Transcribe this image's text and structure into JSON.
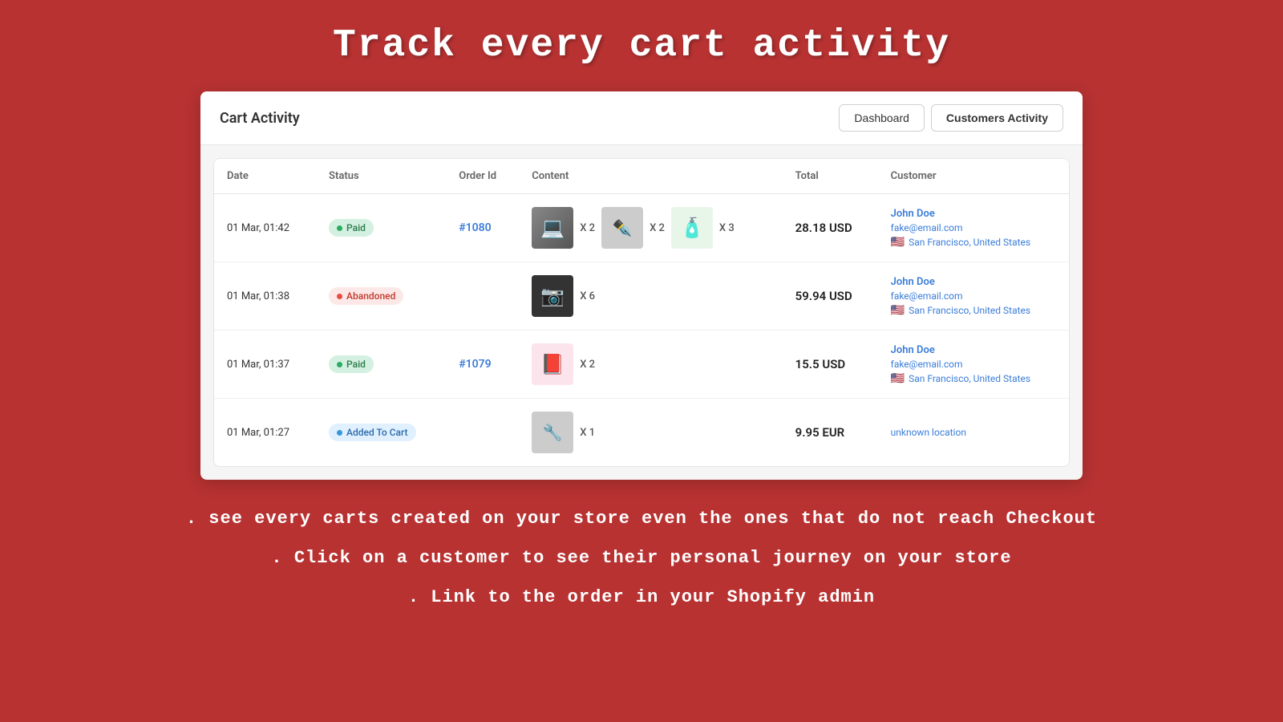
{
  "page": {
    "main_title": "Track every cart activity",
    "features": [
      ". see every carts created on your store even the ones that do not reach Checkout",
      ". Click on a customer to see their personal journey on your store",
      ". Link to the order in your Shopify admin"
    ]
  },
  "header": {
    "title": "Cart Activity",
    "buttons": [
      {
        "label": "Dashboard",
        "active": false
      },
      {
        "label": "Customers Activity",
        "active": true
      }
    ]
  },
  "table": {
    "columns": [
      "Date",
      "Status",
      "Order Id",
      "Content",
      "Total",
      "Customer"
    ],
    "rows": [
      {
        "date": "01 Mar, 01:42",
        "status": "Paid",
        "status_type": "paid",
        "order_id": "#1080",
        "order_link": "#1080",
        "products": [
          {
            "type": "laptop",
            "qty": "X 2"
          },
          {
            "type": "pen",
            "qty": "X 2"
          },
          {
            "type": "bottle",
            "qty": "X 3"
          }
        ],
        "total": "28.18 USD",
        "customer": {
          "name": "John Doe",
          "email": "fake@email.com",
          "flag": "🇺🇸",
          "location": "San Francisco, United States"
        }
      },
      {
        "date": "01 Mar, 01:38",
        "status": "Abandoned",
        "status_type": "abandoned",
        "order_id": "",
        "products": [
          {
            "type": "camera",
            "qty": "X 6"
          }
        ],
        "total": "59.94 USD",
        "customer": {
          "name": "John Doe",
          "email": "fake@email.com",
          "flag": "🇺🇸",
          "location": "San Francisco, United States"
        }
      },
      {
        "date": "01 Mar, 01:37",
        "status": "Paid",
        "status_type": "paid",
        "order_id": "#1079",
        "order_link": "#1079",
        "products": [
          {
            "type": "book",
            "qty": "X 2"
          }
        ],
        "total": "15.5 USD",
        "customer": {
          "name": "John Doe",
          "email": "fake@email.com",
          "flag": "🇺🇸",
          "location": "San Francisco, United States"
        }
      },
      {
        "date": "01 Mar, 01:27",
        "status": "Added To Cart",
        "status_type": "added",
        "order_id": "",
        "products": [
          {
            "type": "tool",
            "qty": "X 1"
          }
        ],
        "total": "9.95 EUR",
        "customer": {
          "name": "",
          "email": "",
          "flag": "",
          "location": "unknown location"
        }
      }
    ]
  }
}
